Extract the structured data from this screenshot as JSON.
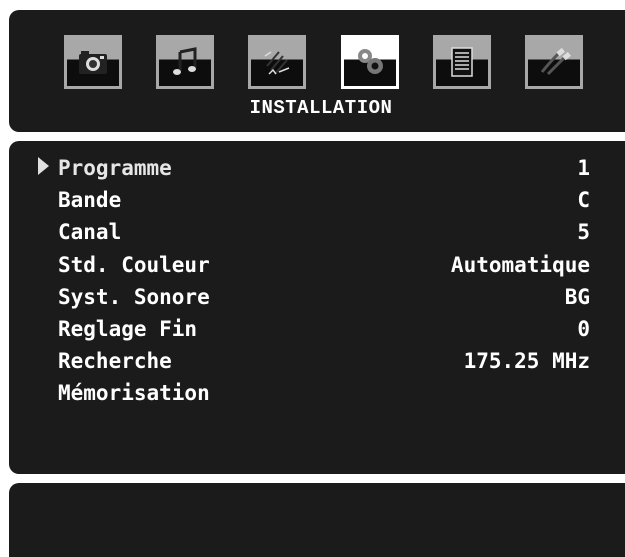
{
  "toolbar": {
    "tabs": [
      {
        "icon": "camera-icon",
        "active": false
      },
      {
        "icon": "music-note-icon",
        "active": false
      },
      {
        "icon": "picture-settings-icon",
        "active": false
      },
      {
        "icon": "gears-icon",
        "active": true
      },
      {
        "icon": "teletext-page-icon",
        "active": false
      },
      {
        "icon": "av-cable-icon",
        "active": false
      }
    ],
    "title": "INSTALLATION"
  },
  "menu": {
    "selected_index": 0,
    "items": [
      {
        "label": "Programme",
        "value": "1"
      },
      {
        "label": "Bande",
        "value": "C"
      },
      {
        "label": "Canal",
        "value": "5"
      },
      {
        "label": "Std. Couleur",
        "value": "Automatique"
      },
      {
        "label": "Syst. Sonore",
        "value": "BG"
      },
      {
        "label": "Reglage Fin",
        "value": "0"
      },
      {
        "label": "Recherche",
        "value": "175.25 MHz"
      },
      {
        "label": "Mémorisation",
        "value": ""
      }
    ]
  },
  "colors": {
    "panel_background": "#1b1b1b",
    "text": "#ffffff",
    "tab_inactive": "#a8a8a8",
    "tab_active": "#ffffff"
  }
}
